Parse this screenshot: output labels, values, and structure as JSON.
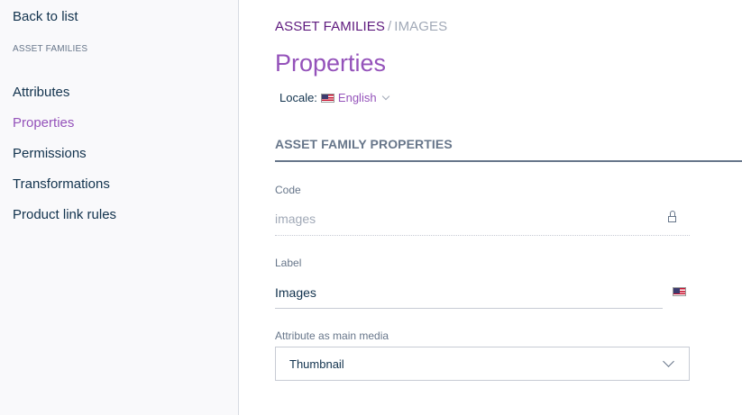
{
  "sidebar": {
    "back_label": "Back to list",
    "section_title": "ASSET FAMILIES",
    "items": [
      {
        "label": "Attributes"
      },
      {
        "label": "Properties"
      },
      {
        "label": "Permissions"
      },
      {
        "label": "Transformations"
      },
      {
        "label": "Product link rules"
      }
    ],
    "active_item": "Properties"
  },
  "breadcrumb": {
    "parent": "ASSET FAMILIES",
    "separator": "/",
    "current": "IMAGES"
  },
  "page": {
    "title": "Properties",
    "locale_label": "Locale:",
    "locale_value": "English",
    "locale_flag_icon": "us-flag-icon"
  },
  "section": {
    "title": "ASSET FAMILY PROPERTIES"
  },
  "fields": {
    "code": {
      "label": "Code",
      "value": "images",
      "icon": "lock-icon"
    },
    "label": {
      "label": "Label",
      "value": "Images",
      "icon": "us-flag-icon"
    },
    "main_media": {
      "label": "Attribute as main media",
      "value": "Thumbnail"
    }
  },
  "colors": {
    "accent": "#9452ba",
    "breadcrumb_link": "#5e1a7e",
    "text": "#11324d",
    "muted": "#67768a",
    "sidebar_bg": "#f9f9fb"
  }
}
